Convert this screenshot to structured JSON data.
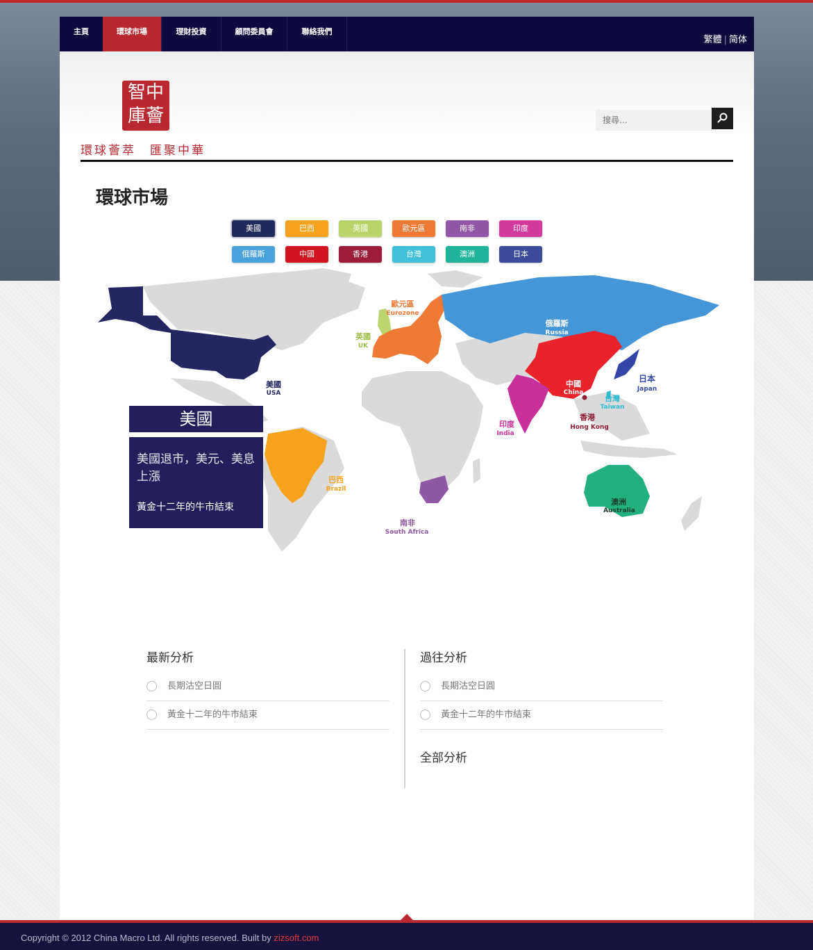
{
  "nav": {
    "items": [
      "主頁",
      "環球市場",
      "理財投資",
      "顧問委員會",
      "聯絡我們"
    ],
    "active_index": 1,
    "lang_trad": "繁體",
    "lang_simp": "简体"
  },
  "logo": {
    "seal_lines": [
      "智中",
      "庫薈"
    ],
    "slogan": "環球薈萃　匯聚中華"
  },
  "search": {
    "placeholder": "搜尋..."
  },
  "page_title": "環球市場",
  "tabs": [
    {
      "label": "美國",
      "color": "#1f2a5a"
    },
    {
      "label": "巴西",
      "color": "#f6a21c"
    },
    {
      "label": "英國",
      "color": "#b9d46a"
    },
    {
      "label": "歐元區",
      "color": "#ef7a35"
    },
    {
      "label": "南非",
      "color": "#9157a6"
    },
    {
      "label": "印度",
      "color": "#d23a9d"
    },
    {
      "label": "俄羅斯",
      "color": "#4aa2dc"
    },
    {
      "label": "中國",
      "color": "#d1141f"
    },
    {
      "label": "香港",
      "color": "#9c1d3a"
    },
    {
      "label": "台灣",
      "color": "#41c1d9"
    },
    {
      "label": "澳洲",
      "color": "#1fb39a"
    },
    {
      "label": "日本",
      "color": "#3d4b9a"
    }
  ],
  "map": {
    "labels": {
      "usa_zh": "美國",
      "usa_en": "USA",
      "brazil_zh": "巴西",
      "brazil_en": "Brazil",
      "uk_zh": "英國",
      "uk_en": "UK",
      "euro_zh": "歐元區",
      "euro_en": "Eurozone",
      "russia_zh": "俄羅斯",
      "russia_en": "Russia",
      "china_zh": "中國",
      "china_en": "China",
      "japan_zh": "日本",
      "japan_en": "Japan",
      "taiwan_zh": "台灣",
      "taiwan_en": "Taiwan",
      "hk_zh": "香港",
      "hk_en": "Hong Kong",
      "india_zh": "印度",
      "india_en": "India",
      "sa_zh": "南非",
      "sa_en": "South Africa",
      "aus_zh": "澳洲",
      "aus_en": "Australia"
    },
    "colors": {
      "land": "#dadada",
      "usa": "#232660",
      "brazil": "#f6a21c",
      "uk": "#bcd56e",
      "euro": "#ef7a35",
      "russia": "#4596d6",
      "china": "#e8232a",
      "japan": "#3545a5",
      "taiwan": "#30bcd0",
      "hk": "#8f1b34",
      "india": "#c92f9a",
      "sa": "#8e58a4",
      "aus": "#22b07e"
    }
  },
  "panel": {
    "title": "美國",
    "line1": "美國退市，美元、美息上漲",
    "line2": "黃金十二年的牛市結束"
  },
  "latest": {
    "title": "最新分析",
    "items": [
      "長期沽空日圓",
      "黃金十二年的牛市結束"
    ]
  },
  "past": {
    "title": "過往分析",
    "items": [
      "長期沽空日圓",
      "黃金十二年的牛市結束"
    ],
    "all_label": "全部分析"
  },
  "footer": {
    "text": "Copyright © 2012 China Macro Ltd. All rights reserved. Built by ",
    "link": "zizsoft.com"
  }
}
